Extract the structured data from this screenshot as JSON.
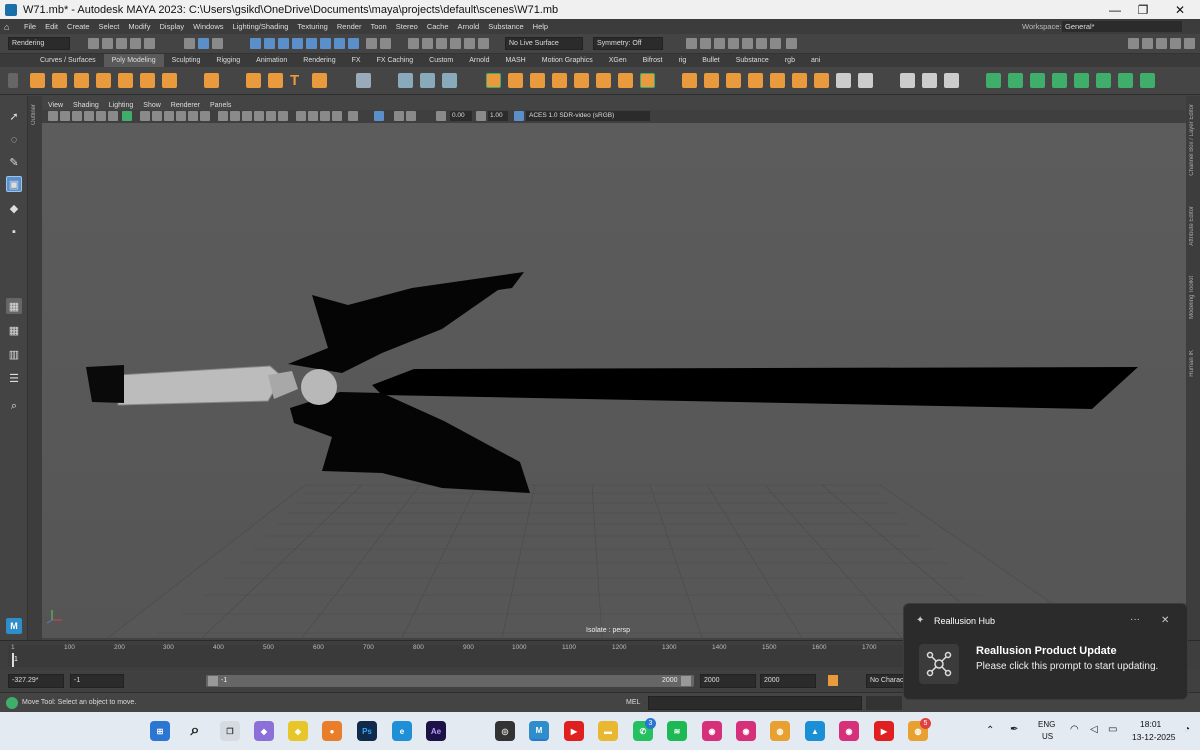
{
  "window": {
    "title": "W71.mb* - Autodesk MAYA 2023: C:\\Users\\gsikd\\OneDrive\\Documents\\maya\\projects\\default\\scenes\\W71.mb",
    "minimize": "—",
    "maximize": "❐",
    "close": "✕"
  },
  "menubar": {
    "items": [
      "File",
      "Edit",
      "Create",
      "Select",
      "Modify",
      "Display",
      "Windows",
      "Lighting/Shading",
      "Texturing",
      "Render",
      "Toon",
      "Stereo",
      "Cache",
      "Arnold",
      "Substance",
      "Help"
    ],
    "workspace_label": "Workspace:",
    "workspace_value": "General*"
  },
  "statusline": {
    "menuset": "Rendering",
    "live_surface": "No Live Surface",
    "symmetry": "Symmetry: Off"
  },
  "shelf": {
    "tabs": [
      "Curves / Surfaces",
      "Poly Modeling",
      "Sculpting",
      "Rigging",
      "Animation",
      "Rendering",
      "FX",
      "FX Caching",
      "Custom",
      "Arnold",
      "MASH",
      "Motion Graphics",
      "XGen",
      "Bifrost",
      "rig",
      "Bullet",
      "Substance",
      "rgb",
      "ani"
    ],
    "active_tab": "Poly Modeling"
  },
  "outliner_label": "Outliner",
  "right_strip_labels": [
    "Channel Box / Layer Editor",
    "Attribute Editor",
    "Modeling Toolkit",
    "Human IK"
  ],
  "panel": {
    "menus": [
      "View",
      "Shading",
      "Lighting",
      "Show",
      "Renderer",
      "Panels"
    ],
    "exposure": "0.00",
    "gamma": "1.00",
    "color_space": "ACES 1.0 SDR-video (sRGB)",
    "camera_label": "Isolate : persp"
  },
  "timeline": {
    "ticks": [
      "1",
      "100",
      "200",
      "300",
      "400",
      "500",
      "600",
      "700",
      "800",
      "900",
      "1000",
      "1100",
      "1200",
      "1300",
      "1400",
      "1500",
      "1600",
      "1700"
    ],
    "current_frame": "1"
  },
  "range": {
    "current_time": "-327.29*",
    "start": "-1",
    "range_start": "-1",
    "range_end": "2000",
    "anim_end": "2000",
    "playback_end": "2000",
    "char_set": "No Character Set"
  },
  "helpline": {
    "message": "Move Tool: Select an object to move.",
    "mel_label": "MEL"
  },
  "notification": {
    "app_name": "Reallusion Hub",
    "more": "···",
    "close": "✕",
    "title": "Reallusion Product Update",
    "body": "Please click this prompt to start updating."
  },
  "taskbar": {
    "whatsapp_badge": "3",
    "chrome_badge": "5",
    "lang_top": "ENG",
    "lang_bottom": "US",
    "time": "18:01",
    "date": "13-12-2025"
  },
  "colors": {
    "maya_bg": "#444444",
    "viewport_bg": "#5e5e5e",
    "accent_blue": "#5b8fc9",
    "shelf_orange": "#e89a3c",
    "shelf_green": "#3fae6a"
  }
}
